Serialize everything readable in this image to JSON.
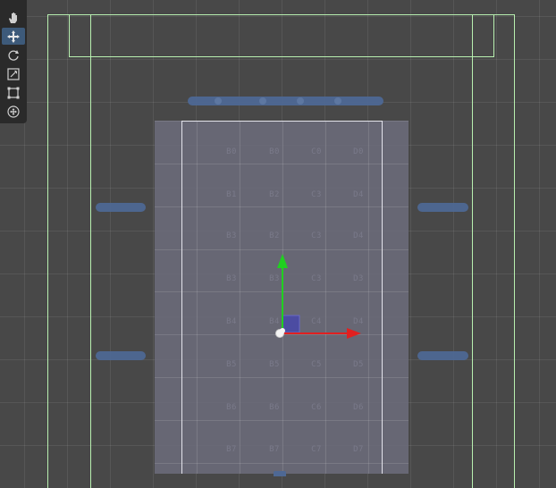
{
  "toolbar": {
    "tools": [
      {
        "name": "hand-tool-button",
        "icon": "hand-icon",
        "active": false
      },
      {
        "name": "move-tool-button",
        "icon": "move-icon",
        "active": true
      },
      {
        "name": "rotate-tool-button",
        "icon": "rotate-icon",
        "active": false
      },
      {
        "name": "scale-tool-button",
        "icon": "scale-icon",
        "active": false
      },
      {
        "name": "rect-tool-button",
        "icon": "rect-transform-icon",
        "active": false
      },
      {
        "name": "transform-tool-button",
        "icon": "transform-icon",
        "active": false
      }
    ]
  },
  "grid": {
    "rows": [
      [
        "B0",
        "B0",
        "C0",
        "D0"
      ],
      [
        "B1",
        "B2",
        "C3",
        "D4"
      ],
      [
        "B3",
        "B2",
        "C3",
        "D4"
      ],
      [
        "B3",
        "B3",
        "C3",
        "D3"
      ],
      [
        "B4",
        "B4",
        "C4",
        "D4"
      ],
      [
        "B5",
        "B5",
        "C5",
        "D5"
      ],
      [
        "B6",
        "B6",
        "C6",
        "D6"
      ],
      [
        "B7",
        "B7",
        "C7",
        "D7"
      ]
    ]
  },
  "colors": {
    "frame": "#b8f0b0",
    "x_axis": "#e02020",
    "y_axis": "#20d020",
    "z_plane": "#4a4aa8",
    "slot": "#4e6894",
    "active_tool": "#3d5a7a"
  }
}
